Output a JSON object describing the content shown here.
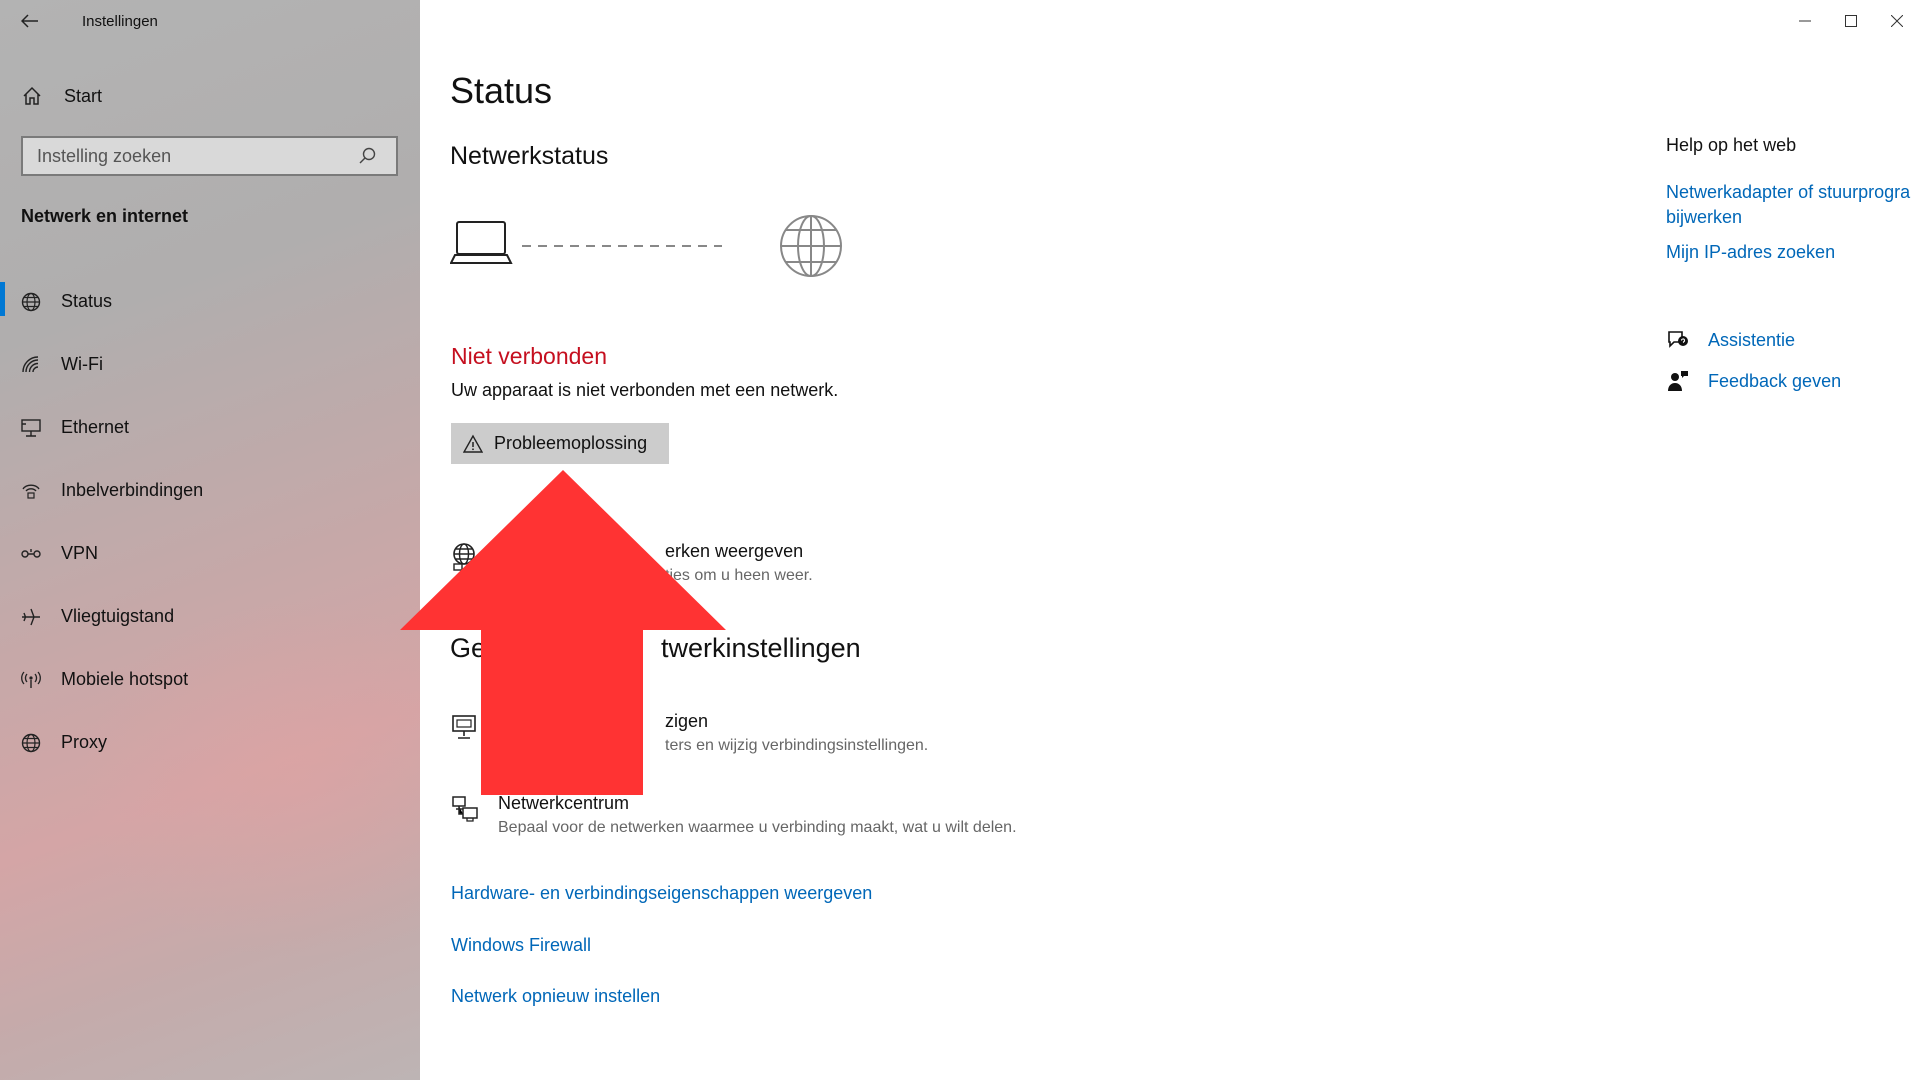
{
  "window": {
    "title": "Instellingen"
  },
  "sidebar": {
    "home_label": "Start",
    "search_placeholder": "Instelling zoeken",
    "section_title": "Netwerk en internet",
    "items": [
      {
        "label": "Status",
        "icon": "globe-icon",
        "active": true
      },
      {
        "label": "Wi-Fi",
        "icon": "wifi-icon"
      },
      {
        "label": "Ethernet",
        "icon": "ethernet-icon"
      },
      {
        "label": "Inbelverbindingen",
        "icon": "dialup-icon"
      },
      {
        "label": "VPN",
        "icon": "vpn-icon"
      },
      {
        "label": "Vliegtuigstand",
        "icon": "airplane-icon"
      },
      {
        "label": "Mobiele hotspot",
        "icon": "hotspot-icon"
      },
      {
        "label": "Proxy",
        "icon": "globe-icon"
      }
    ]
  },
  "main": {
    "title": "Status",
    "network_status_heading": "Netwerkstatus",
    "connection_status": "Niet verbonden",
    "connection_description": "Uw apparaat is niet verbonden met een netwerk.",
    "troubleshoot_label": "Probleemoplossing",
    "available_networks": {
      "title": "erken weergeven",
      "description": "ties om u heen weer."
    },
    "advanced_heading_prefix": "Ge",
    "advanced_heading_suffix": "twerkinstellingen",
    "adapter_options": {
      "title": "zigen",
      "description": "ters en wijzig verbindingsinstellingen."
    },
    "network_center": {
      "title": "Netwerkcentrum",
      "description": "Bepaal voor de netwerken waarmee u verbinding maakt, wat u wilt delen."
    },
    "links": [
      "Hardware- en verbindingseigenschappen weergeven",
      "Windows Firewall",
      "Netwerk opnieuw instellen"
    ]
  },
  "right_panel": {
    "heading": "Help op het web",
    "links": [
      "Netwerkadapter of stuurprogra bijwerken",
      "Mijn IP-adres zoeken"
    ],
    "actions": [
      {
        "label": "Assistentie",
        "icon": "assist-icon"
      },
      {
        "label": "Feedback geven",
        "icon": "feedback-icon"
      }
    ]
  },
  "colors": {
    "accent": "#0067b8",
    "active_indicator": "#0078d4",
    "error": "#c50f1f",
    "overlay_arrow": "#ff3333"
  }
}
